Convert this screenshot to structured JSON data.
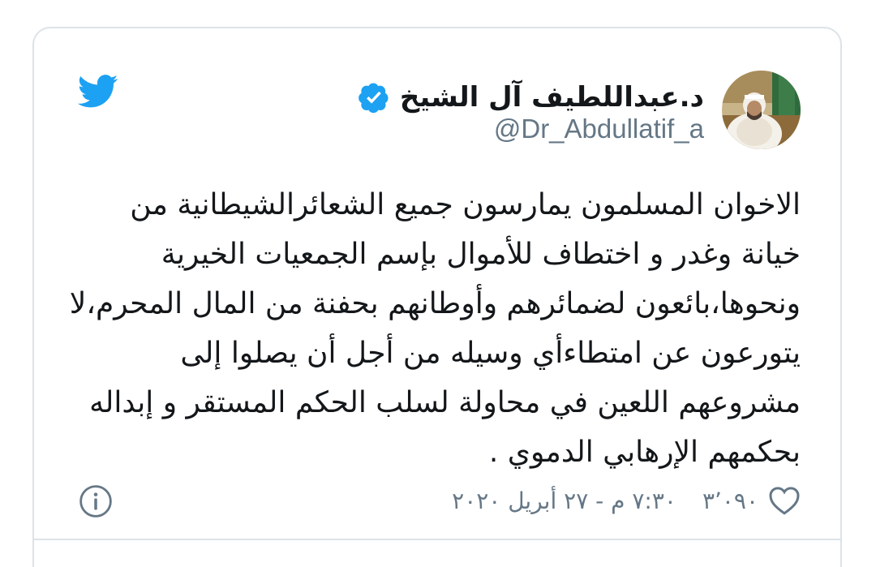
{
  "author": {
    "display_name": "د.عبداللطيف آل الشيخ",
    "handle": "@Dr_Abdullatif_a",
    "verified_icon": "verified-badge-icon",
    "avatar": "profile-photo"
  },
  "brand": {
    "icon": "twitter-bird-icon",
    "color": "#1da1f2"
  },
  "tweet": {
    "lines": [
      "الاخوان المسلمون يمارسون جميع الشعائرالشيطانية من",
      "خيانة وغدر و اختطاف للأموال بإسم الجمعيات الخيرية",
      "ونحوها،بائعون لضمائرهم وأوطانهم بحفنة من المال المحرم،لا",
      "يتورعون عن امتطاءأي وسيله من أجل أن يصلوا إلى",
      "مشروعهم اللعين في محاولة لسلب الحكم المستقر و إبداله",
      "بحكمهم الإرهابي الدموي ."
    ]
  },
  "footer": {
    "like_icon": "heart-icon",
    "like_count": "٣٬٠٩٠",
    "timestamp": "٧:٣٠ م - ٢٧ أبريل ٢٠٢٠",
    "info_icon": "info-icon"
  },
  "colors": {
    "text_primary": "#14171a",
    "text_secondary": "#657786",
    "border": "#dce3e8",
    "verified": "#1da1f2"
  }
}
